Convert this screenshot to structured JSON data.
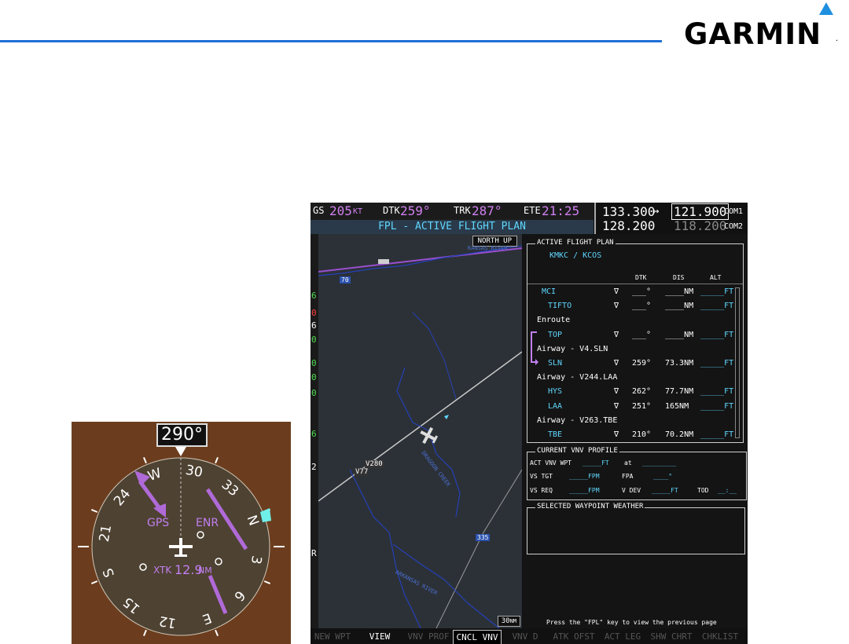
{
  "brand": {
    "name": "GARMIN",
    "reg": "."
  },
  "hsi": {
    "heading": "290°",
    "compass_labels": [
      "N",
      "33",
      "30",
      "W",
      "24",
      "21",
      "S",
      "15",
      "12",
      "E",
      "6",
      "3"
    ],
    "source": "GPS",
    "phase": "ENR",
    "xtk_label": "XTK",
    "xtk_value": "12.9",
    "xtk_unit": "NM"
  },
  "mfd": {
    "topbar": {
      "gs_label": "GS",
      "gs_value": "205",
      "gs_unit": "KT",
      "dtk_label": "DTK",
      "dtk_value": "259°",
      "trk_label": "TRK",
      "trk_value": "287°",
      "ete_label": "ETE",
      "ete_value": "21:25"
    },
    "page_title": "FPL - ACTIVE FLIGHT PLAN",
    "com": {
      "com1_active": "133.300",
      "swap": "↔",
      "com1_standby": "121.900",
      "com1_label": "COM1",
      "com2_active": "128.200",
      "com2_standby": "118.200",
      "com2_label": "COM2"
    },
    "map": {
      "orientation": "NORTH UP",
      "range_value": "30",
      "range_unit": "NM",
      "labels": [
        "KANSAS RIVER",
        "70",
        "V280",
        "V77",
        "ARKANSAS RIVER",
        "335",
        "DRAGOON CREEK"
      ],
      "left_strip_digits": [
        "6",
        "0",
        "6",
        "0",
        "0",
        "0",
        "0",
        "6",
        "2",
        "R"
      ]
    },
    "fpl": {
      "title": "ACTIVE FLIGHT PLAN",
      "route": "KMKC / KCOS",
      "columns": [
        "DTK",
        "DIS",
        "ALT"
      ],
      "rows": [
        {
          "type": "wpt",
          "name": "MCI",
          "dtk": "___°",
          "dis": "____NM",
          "alt": "_____FT"
        },
        {
          "type": "wpt",
          "name": "TIFTO",
          "dtk": "___°",
          "dis": "____NM",
          "alt": "_____FT"
        },
        {
          "type": "hdr",
          "name": "Enroute"
        },
        {
          "type": "wpt",
          "name": "TOP",
          "dtk": "___°",
          "dis": "____NM",
          "alt": "_____FT"
        },
        {
          "type": "hdr",
          "name": "Airway - V4.SLN"
        },
        {
          "type": "wpt",
          "name": "SLN",
          "dtk": "259°",
          "dis": "73.3NM",
          "alt": "_____FT"
        },
        {
          "type": "hdr",
          "name": "Airway - V244.LAA"
        },
        {
          "type": "wpt",
          "name": "HYS",
          "dtk": "262°",
          "dis": "77.7NM",
          "alt": "_____FT"
        },
        {
          "type": "wpt",
          "name": "LAA",
          "dtk": "251°",
          "dis": "165NM",
          "alt": "_____FT"
        },
        {
          "type": "hdr",
          "name": "Airway - V263.TBE"
        },
        {
          "type": "wpt",
          "name": "TBE",
          "dtk": "210°",
          "dis": "70.2NM",
          "alt": "_____FT"
        }
      ],
      "vnv": {
        "title": "CURRENT VNV PROFILE",
        "act_label": "ACT VNV WPT",
        "act_value": "_____FT",
        "at": "at",
        "at_value": "_________",
        "vs_tgt_label": "VS TGT",
        "vs_tgt_value": "_____FPM",
        "fpa_label": "FPA",
        "fpa_value": "____°",
        "vs_req_label": "VS REQ",
        "vs_req_value": "_____FPM",
        "vdev_label": "V DEV",
        "vdev_value": "_____FT",
        "tod_label": "TOD",
        "tod_value": "__:__"
      },
      "weather_title": "SELECTED WAYPOINT WEATHER",
      "footer": "Press the \"FPL\" key to view the previous page"
    },
    "softkeys": [
      "NEW WPT",
      "VIEW",
      "VNV PROF",
      "CNCL VNV",
      "VNV D",
      "ATK OFST",
      "ACT LEG",
      "SHW CHRT",
      "CHKLIST"
    ]
  }
}
